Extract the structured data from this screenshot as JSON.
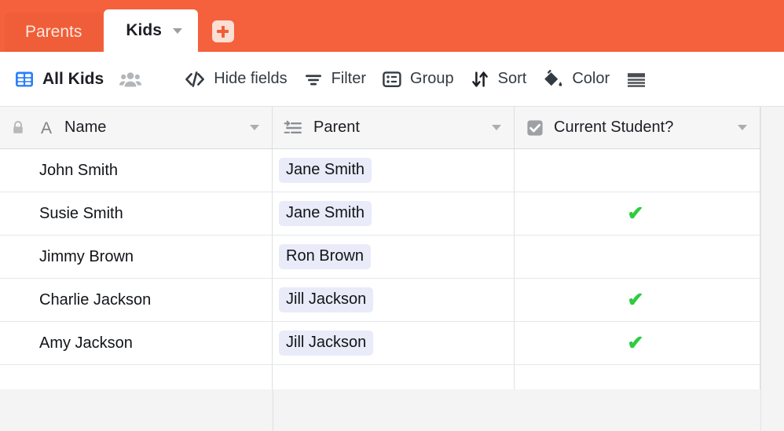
{
  "tabs": {
    "items": [
      {
        "label": "Parents",
        "active": false
      },
      {
        "label": "Kids",
        "active": true
      }
    ],
    "add_tab_icon": "plus-icon",
    "active_tab_caret_icon": "chevron-down-icon"
  },
  "toolbar": {
    "view_icon": "grid-view-icon",
    "view_name": "All Kids",
    "collaborators_icon": "people-icon",
    "buttons": [
      {
        "label": "Hide fields",
        "icon": "hide-fields-icon"
      },
      {
        "label": "Filter",
        "icon": "filter-icon"
      },
      {
        "label": "Group",
        "icon": "group-icon"
      },
      {
        "label": "Sort",
        "icon": "sort-icon"
      },
      {
        "label": "Color",
        "icon": "paint-bucket-icon"
      }
    ],
    "row_height_icon": "row-height-icon"
  },
  "grid": {
    "columns": [
      {
        "name": "Name",
        "type_icon": "text-field-icon",
        "locked": true,
        "lock_icon": "lock-icon",
        "caret_icon": "chevron-down-icon"
      },
      {
        "name": "Parent",
        "type_icon": "linked-record-icon",
        "locked": false,
        "caret_icon": "chevron-down-icon"
      },
      {
        "name": "Current Student?",
        "type_icon": "checkbox-icon",
        "locked": false,
        "caret_icon": "chevron-down-icon"
      }
    ],
    "rows": [
      {
        "name": "John Smith",
        "parent": "Jane Smith",
        "current_student": false
      },
      {
        "name": "Susie Smith",
        "parent": "Jane Smith",
        "current_student": true
      },
      {
        "name": "Jimmy Brown",
        "parent": "Ron Brown",
        "current_student": false
      },
      {
        "name": "Charlie Jackson",
        "parent": "Jill Jackson",
        "current_student": true
      },
      {
        "name": "Amy Jackson",
        "parent": "Jill Jackson",
        "current_student": true
      }
    ],
    "check_mark": "✔"
  },
  "colors": {
    "brand_orange": "#F4613C",
    "tab_inactive": "#EF5E38",
    "accent_blue": "#2D7FF9",
    "check_green": "#2ECC40",
    "chip_bg": "#E9EBF8"
  }
}
